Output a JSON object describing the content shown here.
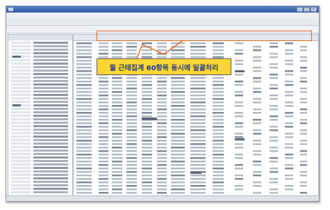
{
  "window": {
    "title": ""
  },
  "menu": [],
  "toolbar": [],
  "annotation": {
    "callout_text": "월 근태집계 60항목 동시에 일괄처리",
    "highlight_color": "#e2671f",
    "callout_bg": "#ffd633",
    "callout_text_color": "#1e3a8a"
  },
  "colors": {
    "titlebar": "#2f56a1",
    "cell_stripe": "#9aa3b1",
    "grid_bg": "#ffffff"
  }
}
